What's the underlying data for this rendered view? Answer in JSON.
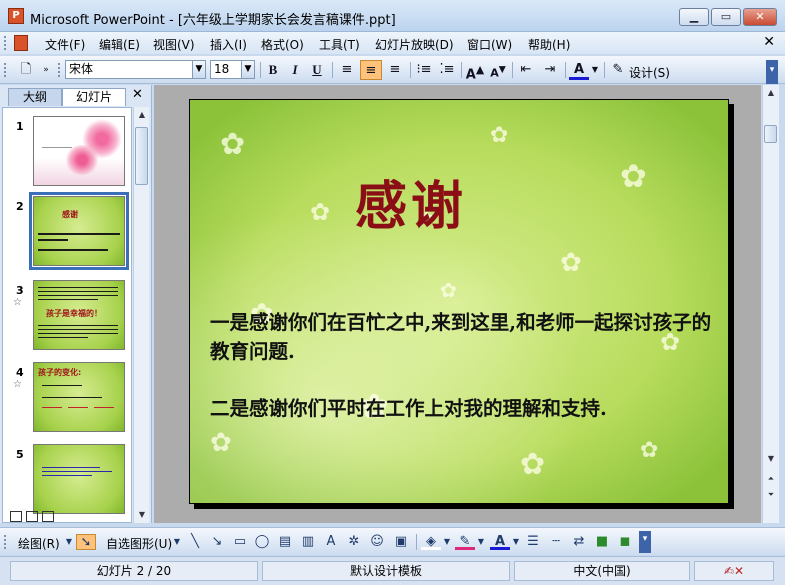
{
  "window": {
    "title": "Microsoft PowerPoint - [六年级上学期家长会发言稿课件.ppt]",
    "app_icon": "powerpoint-icon",
    "controls": [
      "minimize-icon",
      "maximize-icon",
      "close-icon"
    ]
  },
  "menu": {
    "items": [
      "文件(F)",
      "编辑(E)",
      "视图(V)",
      "插入(I)",
      "格式(O)",
      "工具(T)",
      "幻灯片放映(D)",
      "窗口(W)",
      "帮助(H)"
    ],
    "close_glyph": "✕"
  },
  "toolbar": {
    "font_name": "宋体",
    "font_size": "18",
    "bold": "B",
    "italic": "I",
    "underline": "U",
    "design_label": "设计(S)",
    "active_alignment": "center"
  },
  "outline_pane": {
    "tabs": [
      "大纲",
      "幻灯片"
    ],
    "active_tab": "幻灯片",
    "close_glyph": "✕",
    "thumbnails": [
      {
        "number": "1",
        "animated": false,
        "theme": "pink-flowers"
      },
      {
        "number": "2",
        "animated": false,
        "theme": "green",
        "title": "感谢",
        "selected": true
      },
      {
        "number": "3",
        "animated": true,
        "theme": "green",
        "title": "孩子是幸福的！"
      },
      {
        "number": "4",
        "animated": true,
        "theme": "green",
        "title": "孩子的变化:"
      },
      {
        "number": "5",
        "animated": false,
        "theme": "green"
      }
    ]
  },
  "slide": {
    "title": "感谢",
    "paragraph1": "一是感谢你们在百忙之中,来到这里,和老师一起探讨孩子的教育问题.",
    "paragraph2": "二是感谢你们平时在工作上对我的理解和支持."
  },
  "drawing_toolbar": {
    "draw_label": "绘图(R)",
    "autoshapes_label": "自选图形(U)"
  },
  "status": {
    "slide_indicator": "幻灯片 2 / 20",
    "template": "默认设计模板",
    "language": "中文(中国)"
  },
  "colors": {
    "title_red": "#8b0e17",
    "chrome_blue": "#c9d9ee",
    "highlight": "#ffc27a"
  }
}
